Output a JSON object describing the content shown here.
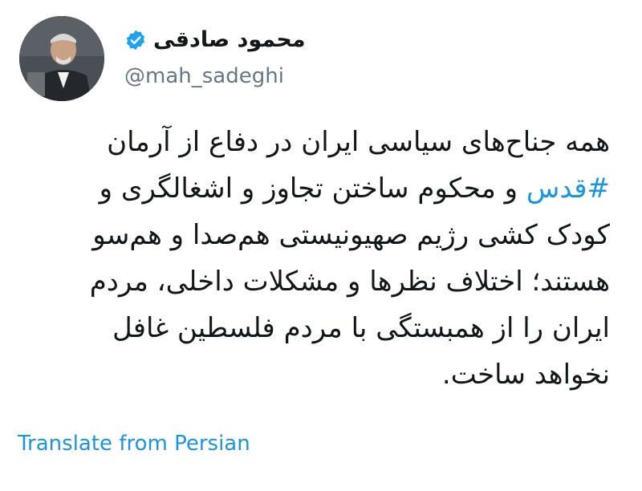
{
  "author": {
    "display_name": "محمود صادقی",
    "handle": "@mah_sadeghi",
    "verified": true
  },
  "tweet": {
    "lines": [
      {
        "text": "همه جناح‌های سیاسی ایران در دفاع از آرمان"
      },
      {
        "hashtag": "#قدس",
        "rest": " و محکوم ساختن تجاوز و اشغالگری و"
      },
      {
        "text": "کودک کشی رژیم صهیونیستی هم‌صدا و هم‌سو"
      },
      {
        "text": "هستند؛ اختلاف نظرها و مشکلات داخلی، مردم"
      },
      {
        "text": "ایران را از همبستگی با مردم فلسطین غافل"
      },
      {
        "text": "نخواهد ساخت."
      }
    ]
  },
  "actions": {
    "translate_label": "Translate from Persian"
  },
  "colors": {
    "link": "#1b95e0",
    "verified": "#1da1f2",
    "handle": "#657786",
    "text": "#14171a"
  },
  "icons": {
    "verified": "verified-badge-icon"
  }
}
